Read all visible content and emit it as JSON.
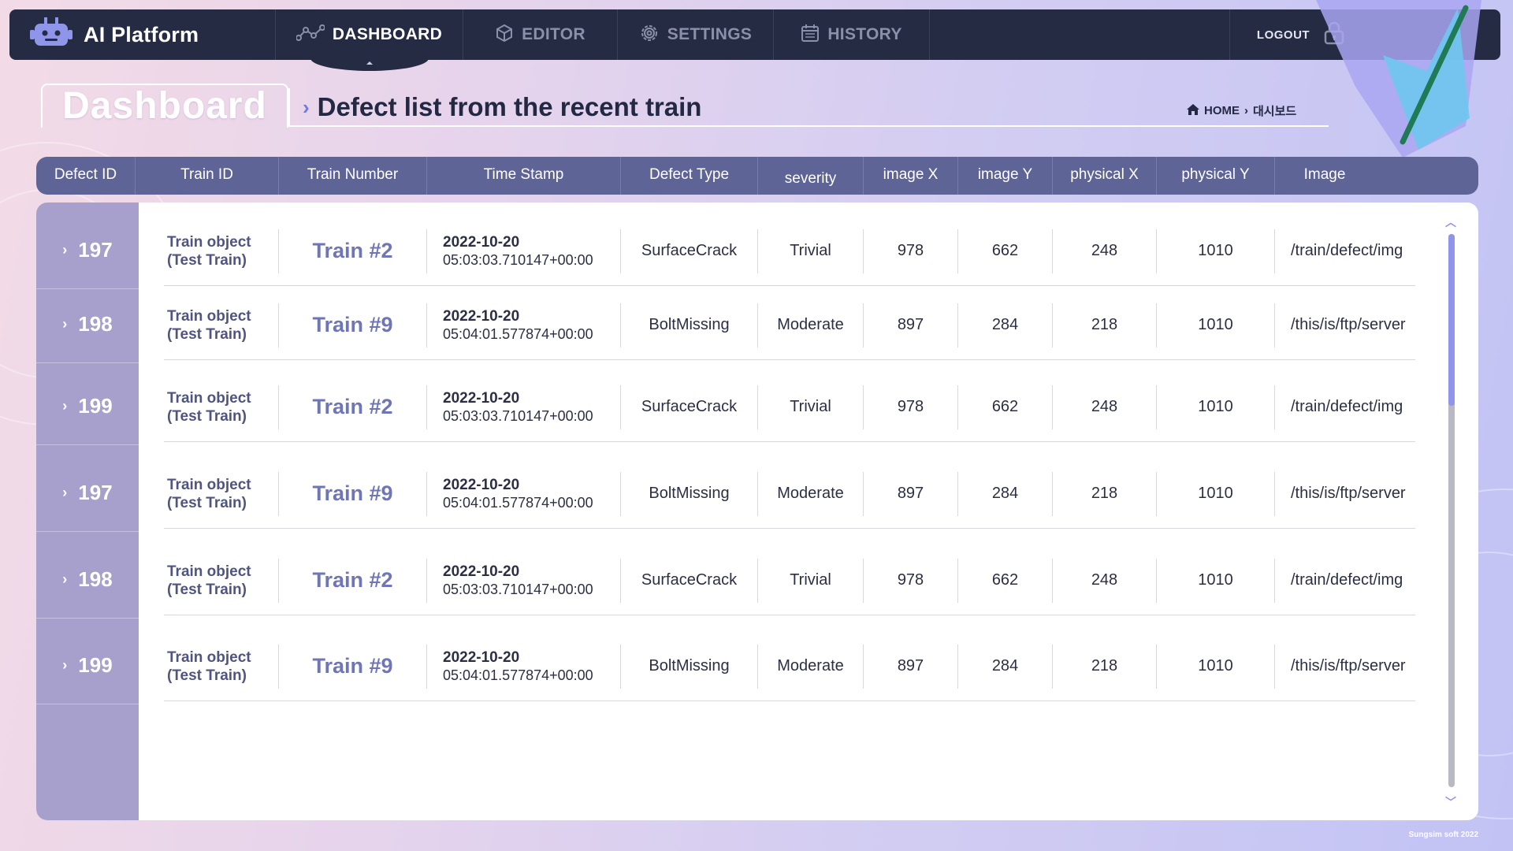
{
  "app": {
    "brand_title": "AI Platform",
    "accent": "#6f7be0",
    "nav_bg": "#252b42"
  },
  "nav": {
    "items": [
      {
        "label": "DASHBOARD",
        "icon": "nodes-icon",
        "active": true
      },
      {
        "label": "EDITOR",
        "icon": "cube-icon",
        "active": false
      },
      {
        "label": "SETTINGS",
        "icon": "gear-icon",
        "active": false
      },
      {
        "label": "HISTORY",
        "icon": "calendar-icon",
        "active": false
      }
    ],
    "logout_label": "LOGOUT"
  },
  "page": {
    "title": "Dashboard",
    "subtitle": "Defect list from the recent train",
    "breadcrumb_home": "HOME",
    "breadcrumb_sep": "›",
    "breadcrumb_current": "대시보드"
  },
  "table": {
    "columns": [
      "Defect ID",
      "Train ID",
      "Train Number",
      "Time Stamp",
      "Defect Type",
      "severity",
      "image X",
      "image Y",
      "physical X",
      "physical Y",
      "Image"
    ],
    "rows": [
      {
        "id": "197",
        "train_id_1": "Train object",
        "train_id_2": "(Test Train)",
        "train_no": "Train #2",
        "date": "2022-10-20",
        "time": "05:03:03.710147+00:00",
        "type": "SurfaceCrack",
        "severity": "Trivial",
        "img_x": "978",
        "img_y": "662",
        "phys_x": "248",
        "phys_y": "1010",
        "image": "/train/defect/img"
      },
      {
        "id": "198",
        "train_id_1": "Train object",
        "train_id_2": "(Test Train)",
        "train_no": "Train #9",
        "date": "2022-10-20",
        "time": "05:04:01.577874+00:00",
        "type": "BoltMissing",
        "severity": "Moderate",
        "img_x": "897",
        "img_y": "284",
        "phys_x": "218",
        "phys_y": "1010",
        "image": "/this/is/ftp/server"
      },
      {
        "id": "199",
        "train_id_1": "Train object",
        "train_id_2": "(Test Train)",
        "train_no": "Train #2",
        "date": "2022-10-20",
        "time": "05:03:03.710147+00:00",
        "type": "SurfaceCrack",
        "severity": "Trivial",
        "img_x": "978",
        "img_y": "662",
        "phys_x": "248",
        "phys_y": "1010",
        "image": "/train/defect/img"
      },
      {
        "id": "197",
        "train_id_1": "Train object",
        "train_id_2": "(Test Train)",
        "train_no": "Train #9",
        "date": "2022-10-20",
        "time": "05:04:01.577874+00:00",
        "type": "BoltMissing",
        "severity": "Moderate",
        "img_x": "897",
        "img_y": "284",
        "phys_x": "218",
        "phys_y": "1010",
        "image": "/this/is/ftp/server"
      },
      {
        "id": "198",
        "train_id_1": "Train object",
        "train_id_2": "(Test Train)",
        "train_no": "Train #2",
        "date": "2022-10-20",
        "time": "05:03:03.710147+00:00",
        "type": "SurfaceCrack",
        "severity": "Trivial",
        "img_x": "978",
        "img_y": "662",
        "phys_x": "248",
        "phys_y": "1010",
        "image": "/train/defect/img"
      },
      {
        "id": "199",
        "train_id_1": "Train object",
        "train_id_2": "(Test Train)",
        "train_no": "Train #9",
        "date": "2022-10-20",
        "time": "05:04:01.577874+00:00",
        "type": "BoltMissing",
        "severity": "Moderate",
        "img_x": "897",
        "img_y": "284",
        "phys_x": "218",
        "phys_y": "1010",
        "image": "/this/is/ftp/server"
      }
    ]
  },
  "footer": {
    "copyright": "Sungsim soft 2022"
  }
}
